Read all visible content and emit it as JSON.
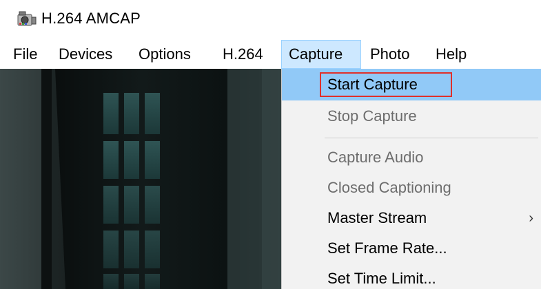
{
  "window": {
    "title": "H.264 AMCAP",
    "icon": "camera-app-icon"
  },
  "menubar": {
    "items": [
      {
        "label": "File"
      },
      {
        "label": "Devices"
      },
      {
        "label": "Options"
      },
      {
        "label": "H.264"
      },
      {
        "label": "Capture",
        "active": true
      },
      {
        "label": "Photo"
      },
      {
        "label": "Help"
      }
    ]
  },
  "capture_menu": {
    "items": [
      {
        "label": "Start Capture",
        "enabled": true,
        "highlighted": true,
        "annotated": true
      },
      {
        "label": "Stop Capture",
        "enabled": false
      },
      {
        "label": "Capture Audio",
        "enabled": false
      },
      {
        "label": "Closed Captioning",
        "enabled": false
      },
      {
        "label": "Master Stream",
        "enabled": true,
        "submenu": true,
        "submenu_glyph": "›"
      },
      {
        "label": "Set Frame Rate...",
        "enabled": true
      },
      {
        "label": "Set Time Limit...",
        "enabled": true
      }
    ]
  },
  "colors": {
    "menu_highlight": "#91c9f7",
    "active_menu_bg": "#cde8ff",
    "annotation_box": "#e0302a",
    "menu_bg": "#f2f2f2"
  }
}
